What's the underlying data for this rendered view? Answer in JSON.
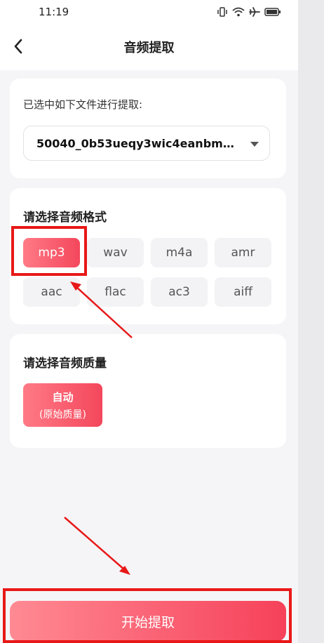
{
  "status_bar": {
    "time": "11:19"
  },
  "nav": {
    "title": "音频提取"
  },
  "file_section": {
    "label": "已选中如下文件进行提取:",
    "selected_file": "50040_0b53ueqy3wic4eanbmmu..."
  },
  "format_section": {
    "title": "请选择音频格式",
    "selected": "mp3",
    "options": [
      "mp3",
      "wav",
      "m4a",
      "amr",
      "aac",
      "flac",
      "ac3",
      "aiff"
    ]
  },
  "quality_section": {
    "title": "请选择音频质量",
    "option_main": "自动",
    "option_sub": "(原始质量)"
  },
  "actions": {
    "start_label": "开始提取"
  },
  "colors": {
    "accent": "#f4475c",
    "accent_light": "#ff7a86",
    "annotation": "#e81818",
    "background": "#f5f5f7"
  }
}
